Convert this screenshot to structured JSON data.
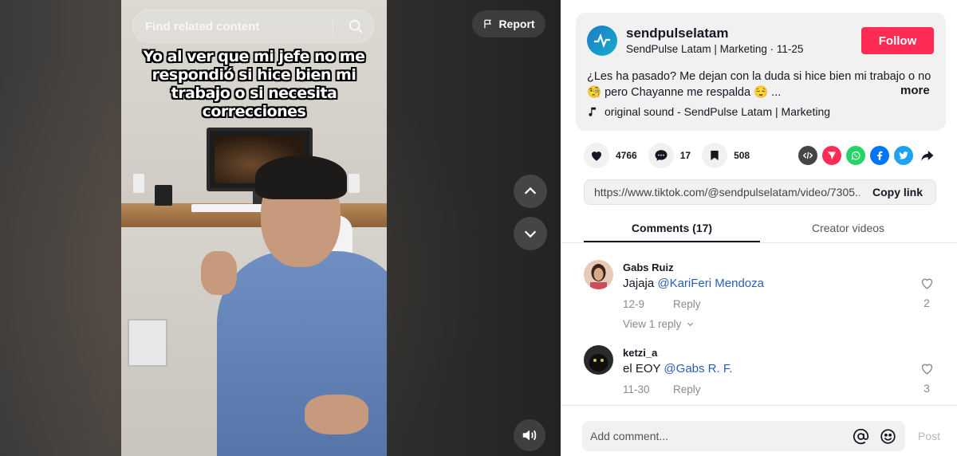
{
  "video": {
    "search_placeholder": "Find related content",
    "report_label": "Report",
    "caption": "Yo al ver que mi jefe no me respondió si hice bien mi trabajo o si necesita correcciones"
  },
  "author": {
    "username": "sendpulselatam",
    "display": "SendPulse Latam | Marketing · 11-25",
    "follow_label": "Follow",
    "description": "¿Les ha pasado? Me dejan con la duda si hice bien mi trabajo o no 🧐 pero Chayanne me respalda 😌 ...",
    "more_label": "more",
    "sound": "original sound - SendPulse Latam | Marketing"
  },
  "actions": {
    "likes": "4766",
    "comments": "17",
    "saves": "508"
  },
  "share": {
    "icons": [
      "embed-icon",
      "send-to-friends-icon",
      "whatsapp-icon",
      "facebook-icon",
      "twitter-icon",
      "share-arrow-icon"
    ],
    "colors": {
      "embed": "#454545",
      "send": "#fe2c55",
      "whatsapp": "#25d366",
      "facebook": "#0075fa",
      "twitter": "#1da1f2"
    }
  },
  "link": {
    "url": "https://www.tiktok.com/@sendpulselatam/video/7305...",
    "copy_label": "Copy link"
  },
  "tabs": [
    {
      "label": "Comments (17)",
      "active": true
    },
    {
      "label": "Creator videos",
      "active": false
    }
  ],
  "comments": [
    {
      "user": "Gabs Ruiz",
      "text": "Jajaja ",
      "mention": "@KariFeri Mendoza",
      "date": "12-9",
      "reply": "Reply",
      "likes": "2",
      "view_replies": "View 1 reply"
    },
    {
      "user": "ketzi_a",
      "text": "el EOY ",
      "mention": "@Gabs R. F.",
      "date": "11-30",
      "reply": "Reply",
      "likes": "3"
    }
  ],
  "composer": {
    "placeholder": "Add comment...",
    "post_label": "Post"
  },
  "colors": {
    "accent": "#fe2c55",
    "mention": "#2b5db9"
  }
}
